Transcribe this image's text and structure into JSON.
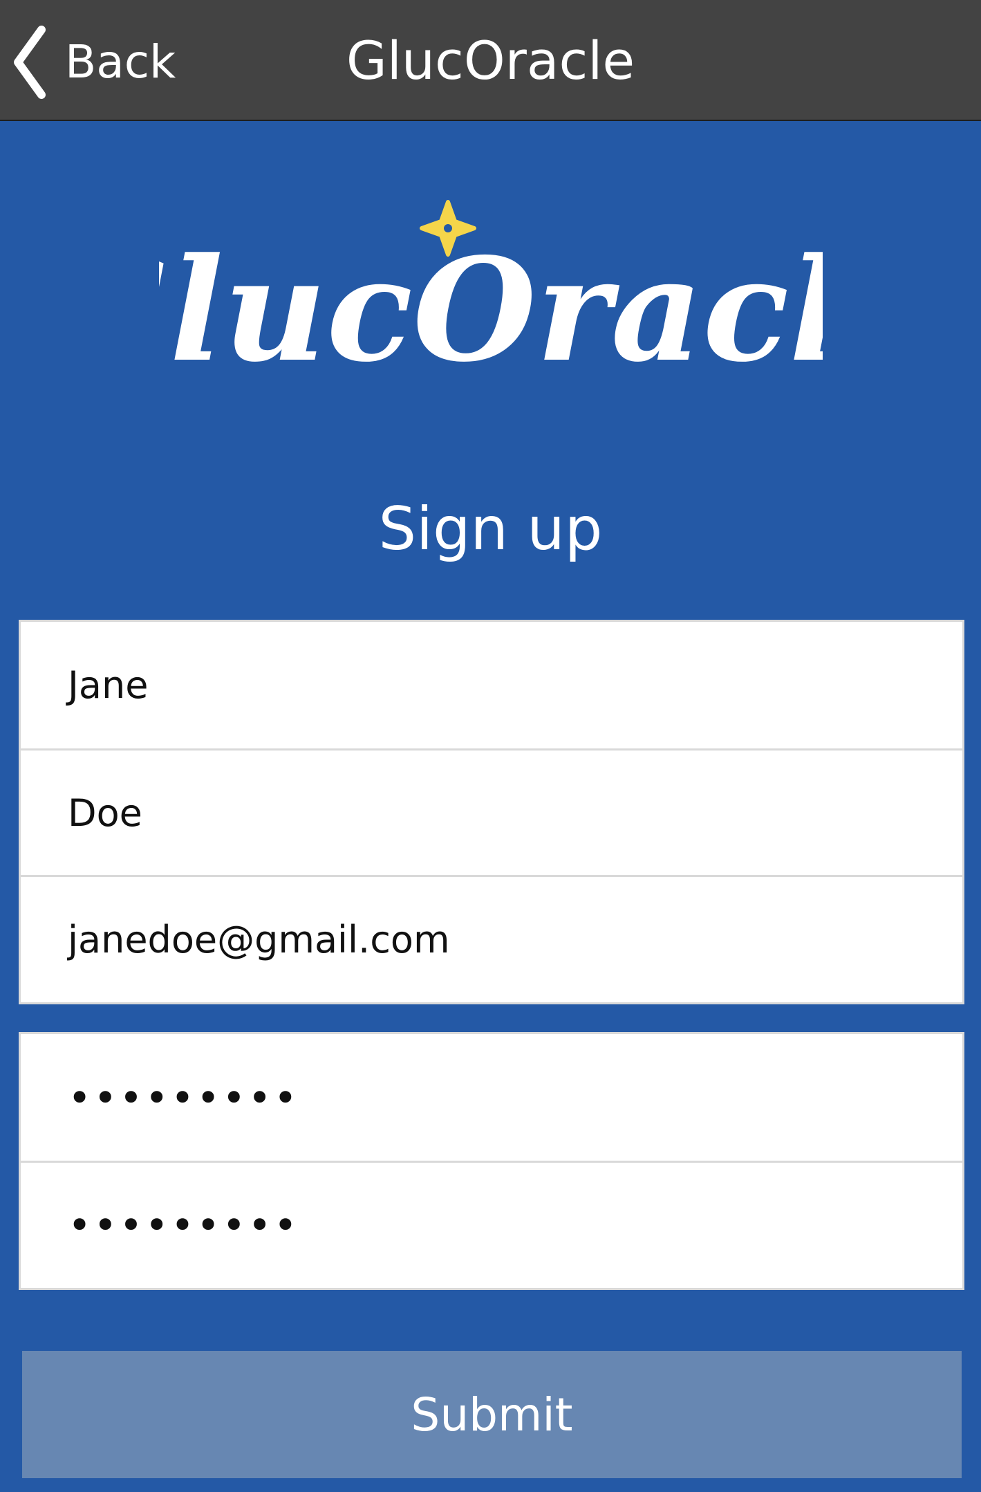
{
  "navbar": {
    "back_label": "Back",
    "title": "GlucOracle",
    "back_icon": "chevron-left-icon",
    "background": "#434343"
  },
  "logo": {
    "text": "GlucOracle",
    "star_color": "#f5d54a",
    "star_icon": "sparkle-star-icon"
  },
  "form": {
    "heading": "Sign up",
    "first_name": "Jane",
    "last_name": "Doe",
    "email": "janedoe@gmail.com",
    "password_masked": "•••••••••",
    "confirm_password_masked": "•••••••••",
    "submit_label": "Submit"
  },
  "colors": {
    "page_background": "#2459a6",
    "submit_background": "#6787b2",
    "field_border": "#d9d9d9"
  }
}
